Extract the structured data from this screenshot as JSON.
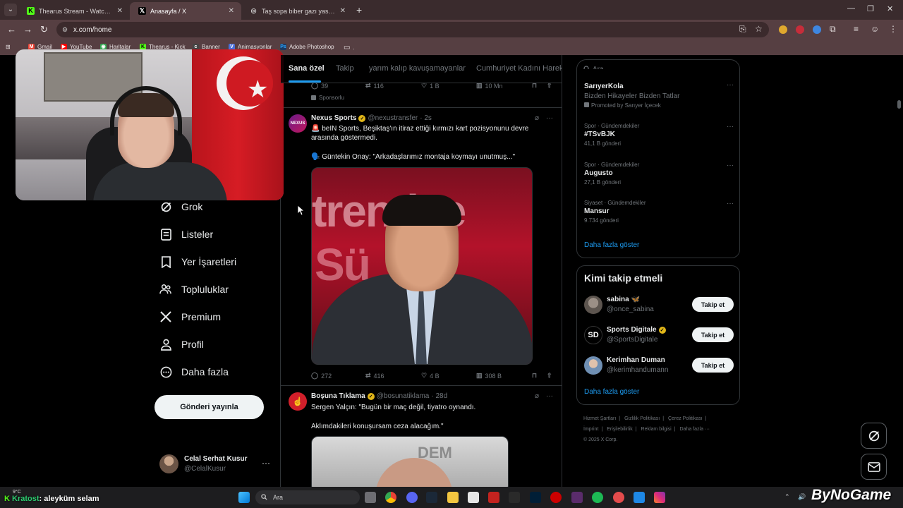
{
  "browser": {
    "tabs": [
      {
        "title": "Thearus Stream - Watch Live on",
        "active": false,
        "favicon": "kick-icon"
      },
      {
        "title": "Anasayfa / X",
        "active": true,
        "favicon": "x-icon"
      },
      {
        "title": "Taş sopa biber gazı yasak mı",
        "active": false,
        "favicon": "globe-icon"
      }
    ],
    "url": "x.com/home",
    "bookmarks": [
      {
        "label": "Gmail",
        "icon": "gmail-icon",
        "color": "#ea4335"
      },
      {
        "label": "YouTube",
        "icon": "youtube-icon",
        "color": "#ff0000"
      },
      {
        "label": "Haritalar",
        "icon": "maps-icon",
        "color": "#34a853"
      },
      {
        "label": "Thearus - Kick",
        "icon": "kick-icon",
        "color": "#53fc18"
      },
      {
        "label": "Banner",
        "icon": "banner-icon",
        "color": "#444444"
      },
      {
        "label": "Animasyonlar",
        "icon": "animation-icon",
        "color": "#4a6fd8"
      },
      {
        "label": "Adobe Photoshop",
        "icon": "photoshop-icon",
        "color": "#1c3a63"
      }
    ]
  },
  "nav": {
    "items": [
      {
        "label": "Grok",
        "icon": "grok-icon"
      },
      {
        "label": "Listeler",
        "icon": "lists-icon"
      },
      {
        "label": "Yer İşaretleri",
        "icon": "bookmark-icon"
      },
      {
        "label": "Topluluklar",
        "icon": "communities-icon"
      },
      {
        "label": "Premium",
        "icon": "x-icon"
      },
      {
        "label": "Profil",
        "icon": "profile-icon"
      },
      {
        "label": "Daha fazla",
        "icon": "more-circle-icon"
      }
    ],
    "post_button": "Gönderi yayınla",
    "account": {
      "name": "Celal Serhat Kusur",
      "handle": "@CelalKusur"
    }
  },
  "feed": {
    "tabs": [
      "Sana özel",
      "Takip",
      "yarım kalıp kavuşamayanlar",
      "Cumhuriyet Kadını Hareke"
    ],
    "prev_tweet_actions": {
      "replies": "39",
      "reposts": "116",
      "likes": "1 B",
      "views": "10 Mn"
    },
    "sponsored_label": "Sponsorlu",
    "tweets": [
      {
        "name": "Nexus Sports",
        "handle": "@nexustransfer",
        "time": "· 2s",
        "text1": "🚨 beIN Sports, Beşiktaş'ın itiraz ettiği kırmızı kart pozisyonunu devre arasında göstermedi.",
        "text2": "🗣️ Güntekin Onay: \"Arkadaşlarımız montaja koymayı unutmuş...\"",
        "avatar_text": "NEXUS",
        "media_text_top": "trendye",
        "media_text_bottom": "Sü   ig",
        "actions": {
          "replies": "272",
          "reposts": "416",
          "likes": "4 B",
          "views": "308 B"
        }
      },
      {
        "name": "Boşuna Tıklama",
        "handle": "@bosunatiklama",
        "time": "· 28d",
        "text1": "Sergen Yalçın: \"Bugün bir maç değil, tiyatro oynandı.",
        "text2": "Aklımdakileri konuşursam ceza alacağım.\"",
        "media_text": "DEM"
      }
    ]
  },
  "sidebar": {
    "search_placeholder": "Ara",
    "trends": [
      {
        "category": "",
        "title": "SarıyerKola",
        "sub": "Bizden Hikayeler Bizden Tatlar",
        "posts": "Promoted by Sarıyer İçecek"
      },
      {
        "category": "Spor · Gündemdekiler",
        "title": "#TSvBJK",
        "posts": "41,1 B gönderi"
      },
      {
        "category": "Spor · Gündemdekiler",
        "title": "Augusto",
        "posts": "27,1 B gönderi"
      },
      {
        "category": "Siyaset · Gündemdekiler",
        "title": "Mansur",
        "posts": "9.734 gönderi"
      }
    ],
    "show_more": "Daha fazla göster",
    "who_to_follow_title": "Kimi takip etmeli",
    "suggestions": [
      {
        "name": "sabina 🦋",
        "handle": "@once_sabina",
        "verified": false
      },
      {
        "name": "Sports Digitale",
        "handle": "@SportsDigitale",
        "verified": true,
        "avatar_text": "SD"
      },
      {
        "name": "Kerimhan Duman",
        "handle": "@kerimhandumann",
        "verified": false
      }
    ],
    "follow_label": "Takip et",
    "show_more2": "Daha fazla göster",
    "footer": [
      "Hizmet Şartları",
      "|",
      "Gizlilik Politikası",
      "|",
      "Çerez Politikası",
      "|",
      "İmprint",
      "|",
      "Erişilebilirlik",
      "|",
      "Reklam bilgisi",
      "|",
      "Daha fazla ···",
      "© 2025 X Corp."
    ]
  },
  "taskbar": {
    "weather": "9°C",
    "search_label": "Ara",
    "chat_user": "Kratost",
    "chat_message": ": aleyküm selam",
    "watermark": "ByNoGame"
  },
  "colors": {
    "accent": "#1d9bf0",
    "verified": "#e2b719",
    "browser_frame": "#563f42"
  }
}
